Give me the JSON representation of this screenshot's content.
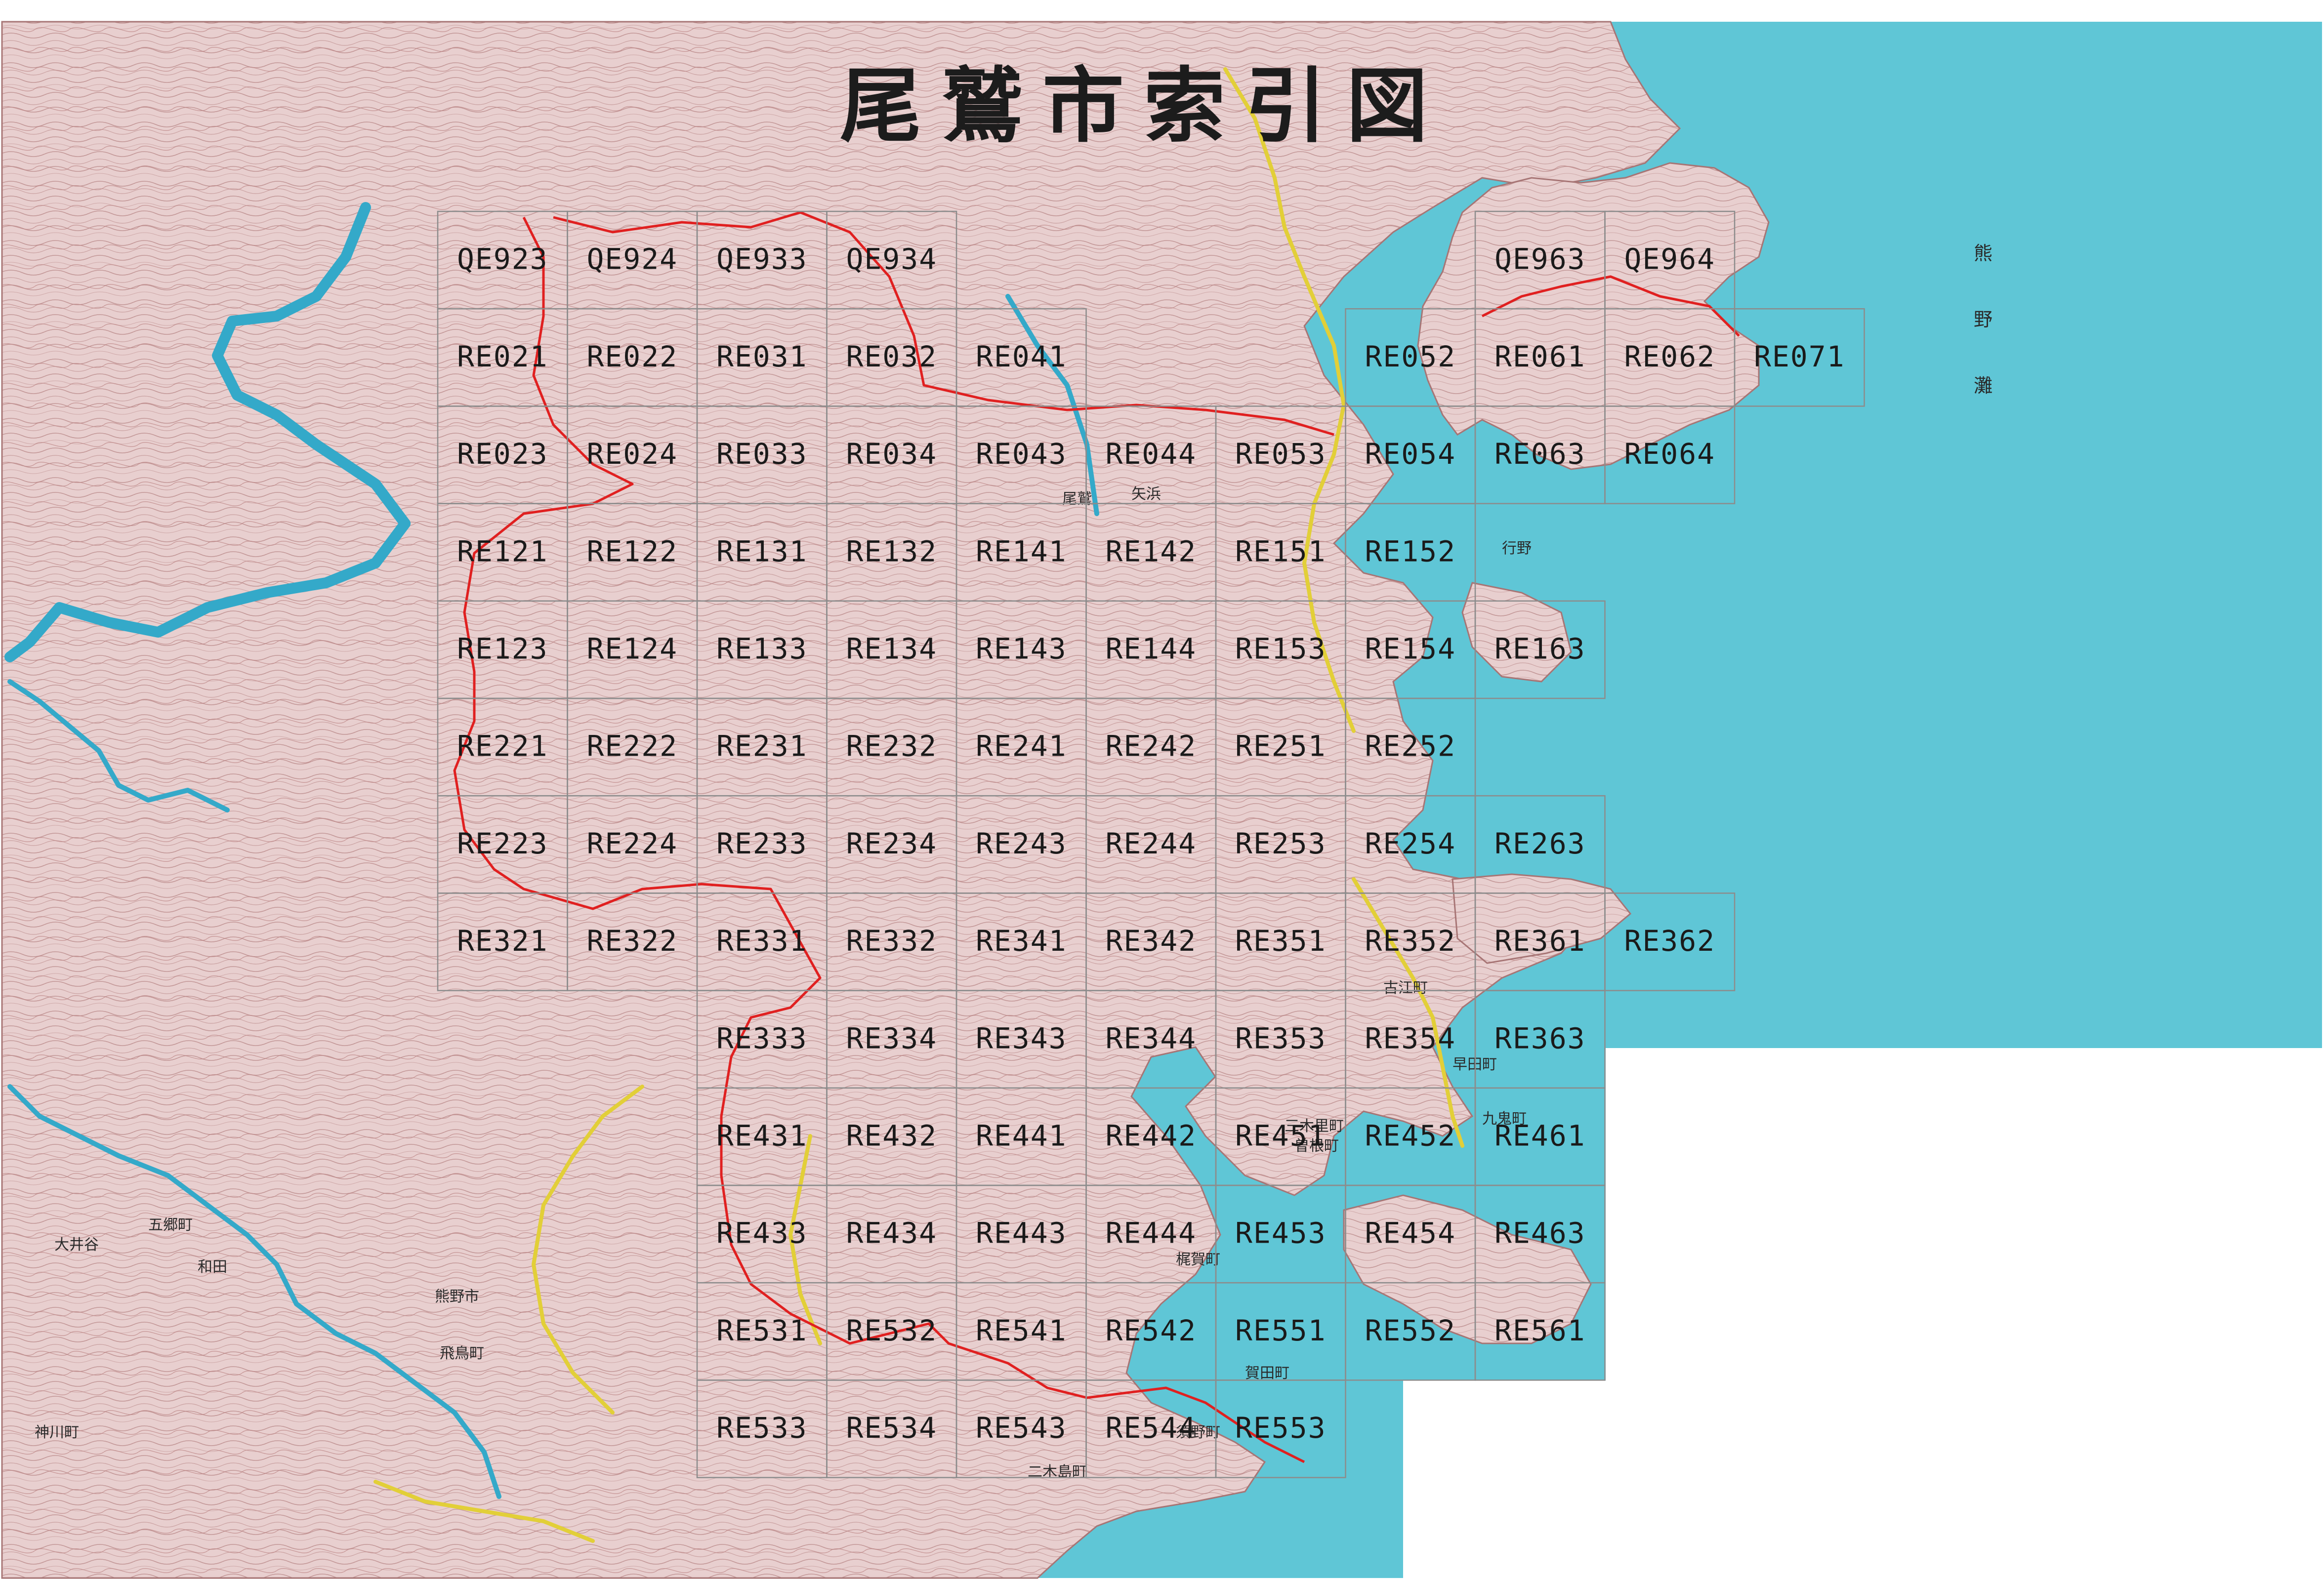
{
  "title": "尾鷲市索引図",
  "colors": {
    "sea": "#5fc6d6",
    "land": "#e8cfcf",
    "contour": "#b98585",
    "boundary": "#e02020",
    "river": "#34a9c9",
    "road": "#e2cf38",
    "grid": "#8c8c8c",
    "label": "#1a1a1a"
  },
  "sheets": [
    [
      "QE923",
      "QE924",
      "QE933",
      "QE934",
      "",
      "",
      "",
      "",
      "QE963",
      "QE964",
      ""
    ],
    [
      "RE021",
      "RE022",
      "RE031",
      "RE032",
      "RE041",
      "",
      "",
      "RE052",
      "RE061",
      "RE062",
      "RE071"
    ],
    [
      "RE023",
      "RE024",
      "RE033",
      "RE034",
      "RE043",
      "RE044",
      "RE053",
      "RE054",
      "RE063",
      "RE064",
      ""
    ],
    [
      "RE121",
      "RE122",
      "RE131",
      "RE132",
      "RE141",
      "RE142",
      "RE151",
      "RE152",
      "",
      "",
      ""
    ],
    [
      "RE123",
      "RE124",
      "RE133",
      "RE134",
      "RE143",
      "RE144",
      "RE153",
      "RE154",
      "RE163",
      "",
      ""
    ],
    [
      "RE221",
      "RE222",
      "RE231",
      "RE232",
      "RE241",
      "RE242",
      "RE251",
      "RE252",
      "",
      "",
      ""
    ],
    [
      "RE223",
      "RE224",
      "RE233",
      "RE234",
      "RE243",
      "RE244",
      "RE253",
      "RE254",
      "RE263",
      "",
      ""
    ],
    [
      "RE321",
      "RE322",
      "RE331",
      "RE332",
      "RE341",
      "RE342",
      "RE351",
      "RE352",
      "RE361",
      "RE362",
      ""
    ],
    [
      "",
      "",
      "RE333",
      "RE334",
      "RE343",
      "RE344",
      "RE353",
      "RE354",
      "RE363",
      "",
      ""
    ],
    [
      "",
      "",
      "RE431",
      "RE432",
      "RE441",
      "RE442",
      "RE451",
      "RE452",
      "RE461",
      "",
      ""
    ],
    [
      "",
      "",
      "RE433",
      "RE434",
      "RE443",
      "RE444",
      "RE453",
      "RE454",
      "RE463",
      "",
      ""
    ],
    [
      "",
      "",
      "RE531",
      "RE532",
      "RE541",
      "RE542",
      "RE551",
      "RE552",
      "RE561",
      "",
      ""
    ],
    [
      "",
      "",
      "RE533",
      "RE534",
      "RE543",
      "RE544",
      "RE553",
      "",
      "",
      "",
      ""
    ]
  ],
  "sea_name_chars": [
    "熊",
    "野",
    "灘"
  ],
  "place_names": [
    "大井谷",
    "和田",
    "五郷町",
    "神川町",
    "飛鳥町",
    "熊野市",
    "二木島町",
    "須野町",
    "賀田町",
    "梶賀町",
    "曽根町",
    "三木里町",
    "古江町",
    "早田町",
    "九鬼町",
    "尾鷲",
    "矢浜",
    "行野"
  ]
}
